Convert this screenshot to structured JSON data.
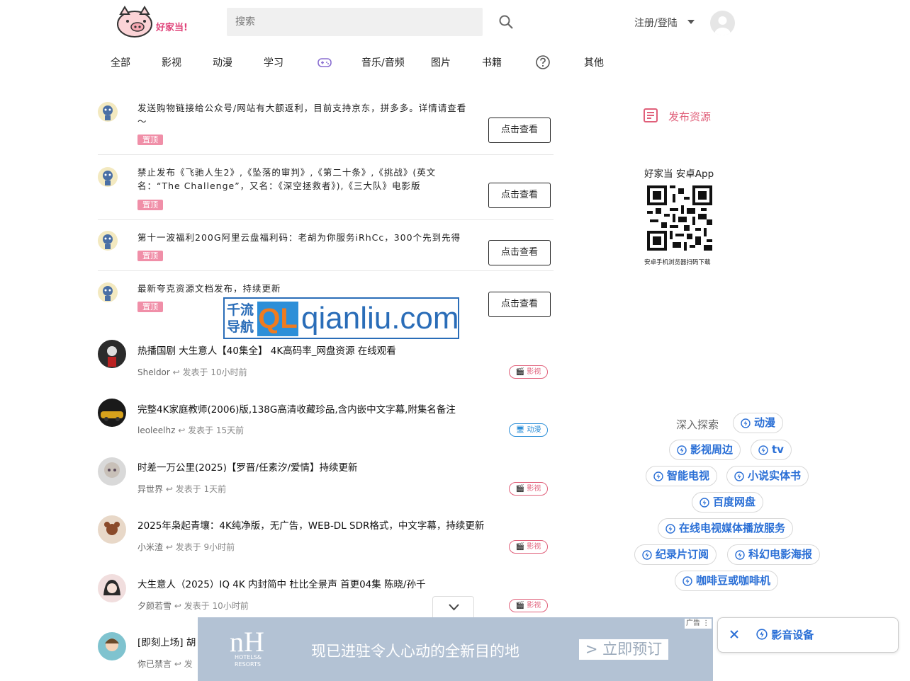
{
  "header": {
    "logo_text": "好家当!",
    "search_placeholder": "搜索",
    "login_label": "注册/登陆"
  },
  "nav": {
    "items": [
      "全部",
      "影视",
      "动漫",
      "学习",
      "音乐/音频",
      "图片",
      "书籍",
      "其他"
    ],
    "icons": [
      "gamepad-icon",
      "question-icon"
    ]
  },
  "pinned": [
    {
      "text": "发送购物链接给公众号/网站有大额返利，目前支持京东，拼多多。详情请查看～",
      "badge": "置顶",
      "button": "点击查看"
    },
    {
      "text": "禁止发布《飞驰人生2》,《坠落的审判》,《第二十条》,《挑战》(英文名：“The Challenge”，又名：《深空拯救者》),《三大队》电影版",
      "badge": "置顶",
      "button": "点击查看"
    },
    {
      "text": "第十一波福利200G阿里云盘福利码：老胡为你服务iRhCc，300个先到先得",
      "badge": "置顶",
      "button": "点击查看"
    },
    {
      "text": "最新夸克资源文档发布，持续更新",
      "badge": "置顶",
      "button": "点击查看"
    }
  ],
  "posts": [
    {
      "title": "热播国剧 大生意人【40集全】 4K高码率_网盘资源 在线观看",
      "author": "Sheldor",
      "time": "发表于 10小时前",
      "tag": "影视"
    },
    {
      "title": "完整4K家庭教师(2006)版,138G高清收藏珍品,含内嵌中文字幕,附集名备注",
      "author": "leoleelhz",
      "time": "发表于 15天前",
      "tag": "动漫"
    },
    {
      "title": "时差一万公里(2025)【罗晋/任素汐/爱情】持续更新",
      "author": "异世界",
      "time": "发表于 1天前",
      "tag": "影视"
    },
    {
      "title": "2025年枭起青壤：4K纯净版，无广告，WEB-DL SDR格式，中文字幕，持续更新",
      "author": "小米渣",
      "time": "发表于 9小时前",
      "tag": "影视"
    },
    {
      "title": "大生意人（2025）IQ 4K 内封简中 杜比全景声 首更04集 陈晓/孙千",
      "author": "夕颜若雪",
      "time": "发表于 10小时前",
      "tag": "影视"
    },
    {
      "title": "[即刻上场] 胡",
      "author": "你已禁言",
      "time": "发",
      "tag": ""
    }
  ],
  "watermark": {
    "cn_line1": "千流",
    "cn_line2": "导航",
    "ql": "QL",
    "url": "qianliu.com"
  },
  "sidebar": {
    "publish_label": "发布资源",
    "app_title": "好家当 安卓App",
    "app_subtitle": "安卓手机浏览器扫码下载",
    "explore_label": "深入探索",
    "chips": [
      "动漫",
      "影视周边",
      "tv",
      "智能电视",
      "小说实体书",
      "百度网盘",
      "在线电视媒体播放服务",
      "纪录片订阅",
      "科幻电影海报",
      "咖啡豆或咖啡机"
    ]
  },
  "ad": {
    "logo": "nH",
    "logo_sub1": "HOTELS&",
    "logo_sub2": "RESORTS",
    "slogan": "现已进驻令人心动的全新目的地",
    "cta": "> 立即预订",
    "badge": "广告"
  },
  "floating": {
    "chip": "影音设备"
  },
  "colors": {
    "accent_pink": "#e0607a",
    "accent_blue": "#2a6fd6",
    "badge_pink": "#f08fa8",
    "ad_bg": "#b3c2d4"
  }
}
